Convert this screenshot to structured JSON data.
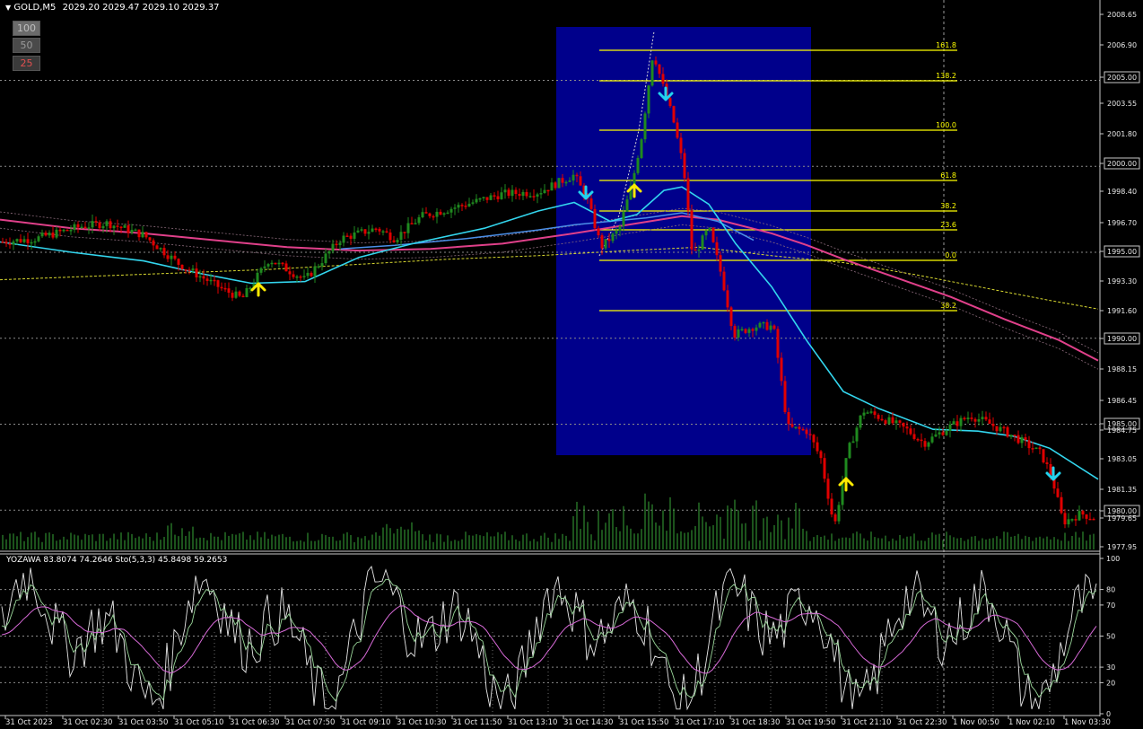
{
  "header": {
    "symbol": "GOLD,M5",
    "ohlc": "2029.20 2029.47 2029.10 2029.37"
  },
  "zoom_buttons": [
    {
      "label": "100",
      "bg": "#6b6b6b",
      "fg": "#bdbdbd"
    },
    {
      "label": "50",
      "bg": "#4a4a4a",
      "fg": "#9a9a9a"
    },
    {
      "label": "25",
      "bg": "#3a3a3a",
      "fg": "#e05050"
    }
  ],
  "price_axis": {
    "ticks": [
      "2008.65",
      "2006.90",
      "2005.00",
      "2003.55",
      "2001.80",
      "2000.00",
      "1998.40",
      "1996.70",
      "1995.00",
      "1993.30",
      "1991.60",
      "1990.00",
      "1988.15",
      "1986.45",
      "1985.00",
      "1984.75",
      "1983.05",
      "1981.35",
      "1980.00",
      "1979.65",
      "1977.95"
    ],
    "boxed": [
      "2005.00",
      "2000.00",
      "1995.00",
      "1990.00",
      "1985.00",
      "1980.00"
    ]
  },
  "fibonacci": {
    "levels": [
      "161.8",
      "138.2",
      "100.0",
      "61.8",
      "38.2",
      "23.6",
      "0.0",
      "38.2"
    ],
    "color": "#ffff00",
    "zone_color": "#00008b"
  },
  "indicator": {
    "label": "YOZAWA 83.8074 74.2646  Sto(5,3,3) 45.8498 59.2653",
    "levels": [
      "100",
      "80",
      "70",
      "50",
      "30",
      "20",
      "0"
    ]
  },
  "time_axis": [
    "31 Oct 2023",
    "31 Oct 02:30",
    "31 Oct 03:50",
    "31 Oct 05:10",
    "31 Oct 06:30",
    "31 Oct 07:50",
    "31 Oct 09:10",
    "31 Oct 10:30",
    "31 Oct 11:50",
    "31 Oct 13:10",
    "31 Oct 14:30",
    "31 Oct 15:50",
    "31 Oct 17:10",
    "31 Oct 18:30",
    "31 Oct 19:50",
    "31 Oct 21:10",
    "31 Oct 22:30",
    "1 Nov 00:50",
    "1 Nov 02:10",
    "1 Nov 03:30"
  ],
  "colors": {
    "bull": "#1f8a1f",
    "bear": "#e00000",
    "cyan_ma": "#33d6ee",
    "blue_ma": "#4a8fe8",
    "pink_ma": "#e0408a",
    "yellow_ma": "#d8d830",
    "arrow_up": "#ffea00",
    "arrow_down": "#22d3ee",
    "volume": "#2e8b2e"
  }
}
